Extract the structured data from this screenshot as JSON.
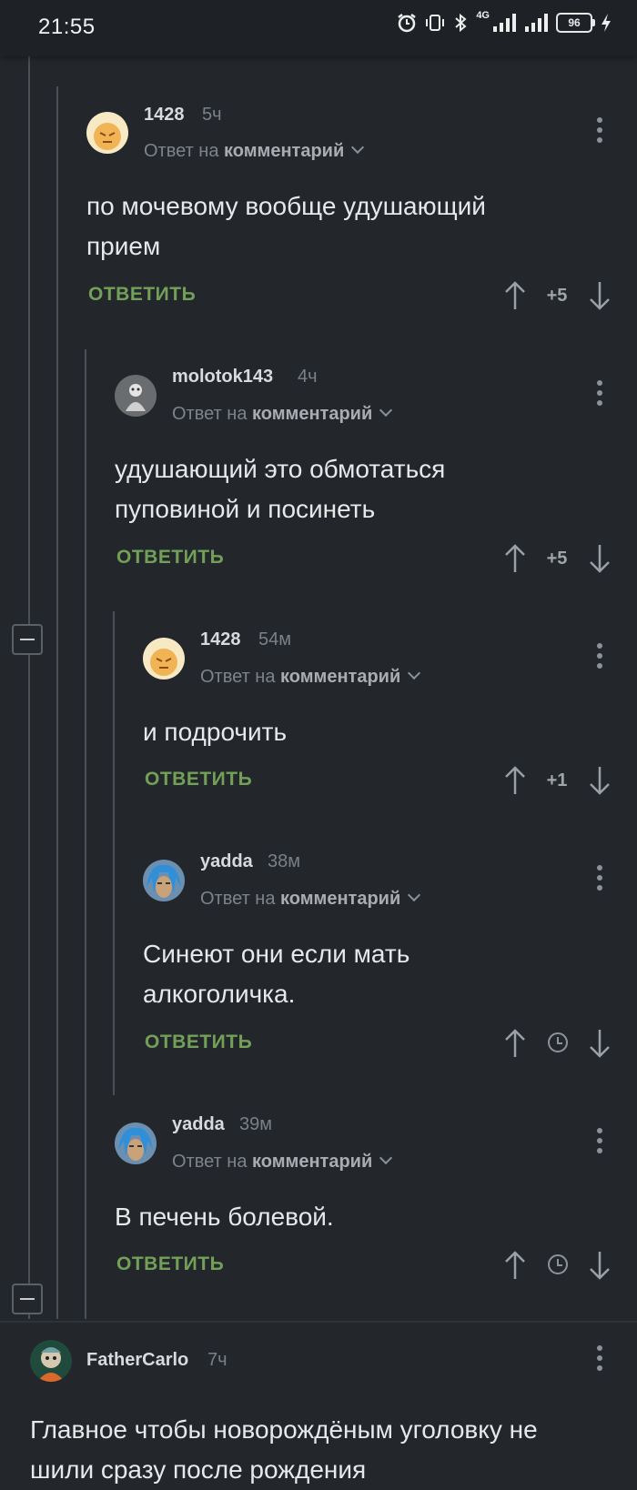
{
  "status_bar": {
    "time": "21:55",
    "network": "4G",
    "battery": "96"
  },
  "comments": [
    {
      "author": "1428",
      "time": "5ч",
      "reply_prefix": "Ответ на",
      "reply_link": "комментарий",
      "lines": [
        "по мочевому вообще удушающий",
        "прием"
      ],
      "reply_label": "ОТВЕТИТЬ",
      "rating": "+5"
    },
    {
      "author": "molotok143",
      "time": "4ч",
      "reply_prefix": "Ответ на",
      "reply_link": "комментарий",
      "lines": [
        "удушающий это обмотаться",
        "пуповиной и посинеть"
      ],
      "reply_label": "ОТВЕТИТЬ",
      "rating": "+5"
    },
    {
      "author": "1428",
      "time": "54м",
      "reply_prefix": "Ответ на",
      "reply_link": "комментарий",
      "lines": [
        "и подрочить"
      ],
      "reply_label": "ОТВЕТИТЬ",
      "rating": "+1"
    },
    {
      "author": "yadda",
      "time": "38м",
      "reply_prefix": "Ответ на",
      "reply_link": "комментарий",
      "lines": [
        "Синеют они если мать",
        "алкоголичка."
      ],
      "reply_label": "ОТВЕТИТЬ",
      "rating": ""
    },
    {
      "author": "yadda",
      "time": "39м",
      "reply_prefix": "Ответ на",
      "reply_link": "комментарий",
      "lines": [
        "В печень болевой."
      ],
      "reply_label": "ОТВЕТИТЬ",
      "rating": ""
    },
    {
      "author": "FatherCarlo",
      "time": "7ч",
      "lines": [
        "Главное чтобы новорождёным уголовку не",
        "шили сразу после рождения"
      ]
    }
  ],
  "icons": {
    "upvote": "arrow-up-icon",
    "downvote": "arrow-down-icon",
    "more": "more-vertical-icon",
    "pending_rating": "clock-icon",
    "collapse": "minus-box-icon",
    "reply_dropdown": "chevron-down-icon"
  },
  "colors": {
    "background": "#23272b",
    "reply_button": "#72a058",
    "text": "#e4e6e8",
    "meta": "#7d8389"
  }
}
